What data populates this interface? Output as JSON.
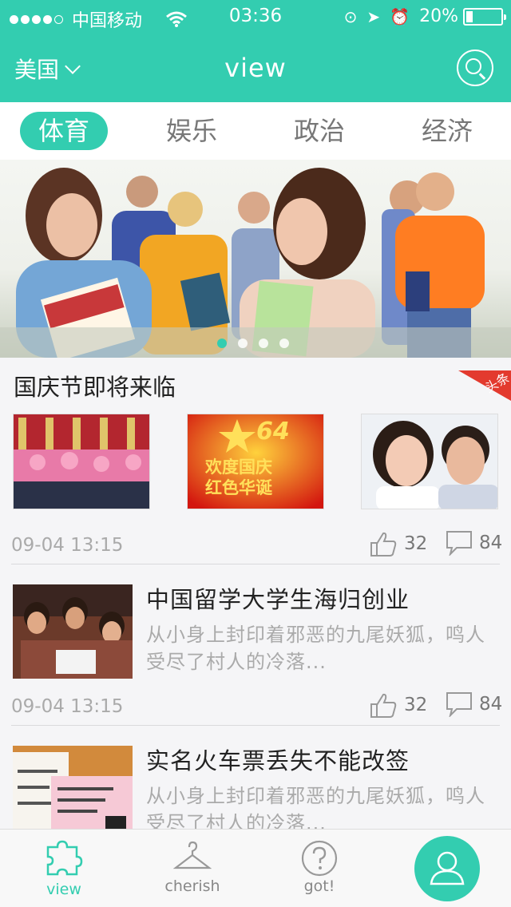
{
  "status_bar": {
    "carrier": "中国移动",
    "time": "03:36",
    "battery_percent": "20%",
    "battery_level": 0.2,
    "signal_bars_filled": 4,
    "signal_bars_total": 5
  },
  "nav": {
    "region": "美国",
    "title": "view"
  },
  "tabs": [
    {
      "label": "体育",
      "active": true
    },
    {
      "label": "娱乐",
      "active": false
    },
    {
      "label": "政治",
      "active": false
    },
    {
      "label": "经济",
      "active": false
    }
  ],
  "banner": {
    "slide_count": 4,
    "active_slide": 1
  },
  "feed": {
    "featured": {
      "title": "国庆节即将来临",
      "badge": "头条",
      "thumb_caption_1": "欢度国庆",
      "thumb_caption_2": "红色华诞",
      "thumb_number": "64",
      "time": "09-04 13:15",
      "likes": "32",
      "comments": "84"
    },
    "items": [
      {
        "title": "中国留学大学生海归创业",
        "desc_line1": "从小身上封印着邪恶的九尾妖狐，鸣人",
        "desc_line2": "受尽了村人的冷落...",
        "time": "09-04 13:15",
        "likes": "32",
        "comments": "84"
      },
      {
        "title": "实名火车票丢失不能改签",
        "desc_line1": "从小身上封印着邪恶的九尾妖狐，鸣人",
        "desc_line2": "受尽了村人的冷落..."
      }
    ]
  },
  "tabbar": {
    "view": "view",
    "cherish": "cherish",
    "got": "got!"
  },
  "colors": {
    "accent": "#33cdb0",
    "badge_red": "#e33a2e"
  }
}
